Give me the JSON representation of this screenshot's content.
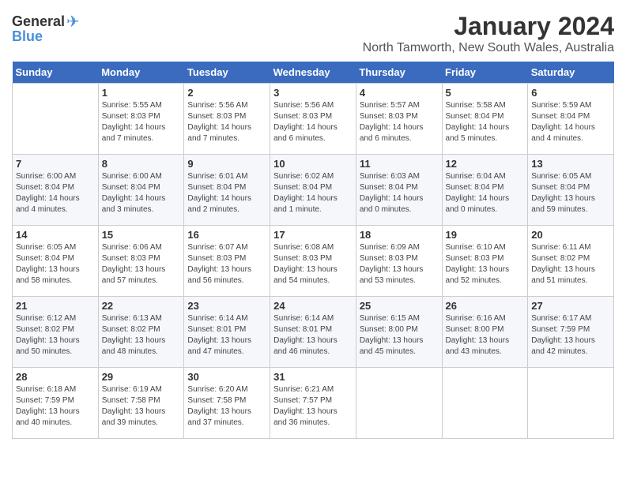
{
  "header": {
    "logo": {
      "general": "General",
      "blue": "Blue"
    },
    "title": "January 2024",
    "location": "North Tamworth, New South Wales, Australia"
  },
  "weekdays": [
    "Sunday",
    "Monday",
    "Tuesday",
    "Wednesday",
    "Thursday",
    "Friday",
    "Saturday"
  ],
  "weeks": [
    [
      {
        "day": "",
        "empty": true
      },
      {
        "day": "1",
        "sunrise": "Sunrise: 5:55 AM",
        "sunset": "Sunset: 8:03 PM",
        "daylight": "Daylight: 14 hours and 7 minutes."
      },
      {
        "day": "2",
        "sunrise": "Sunrise: 5:56 AM",
        "sunset": "Sunset: 8:03 PM",
        "daylight": "Daylight: 14 hours and 7 minutes."
      },
      {
        "day": "3",
        "sunrise": "Sunrise: 5:56 AM",
        "sunset": "Sunset: 8:03 PM",
        "daylight": "Daylight: 14 hours and 6 minutes."
      },
      {
        "day": "4",
        "sunrise": "Sunrise: 5:57 AM",
        "sunset": "Sunset: 8:03 PM",
        "daylight": "Daylight: 14 hours and 6 minutes."
      },
      {
        "day": "5",
        "sunrise": "Sunrise: 5:58 AM",
        "sunset": "Sunset: 8:04 PM",
        "daylight": "Daylight: 14 hours and 5 minutes."
      },
      {
        "day": "6",
        "sunrise": "Sunrise: 5:59 AM",
        "sunset": "Sunset: 8:04 PM",
        "daylight": "Daylight: 14 hours and 4 minutes."
      }
    ],
    [
      {
        "day": "7",
        "sunrise": "Sunrise: 6:00 AM",
        "sunset": "Sunset: 8:04 PM",
        "daylight": "Daylight: 14 hours and 4 minutes."
      },
      {
        "day": "8",
        "sunrise": "Sunrise: 6:00 AM",
        "sunset": "Sunset: 8:04 PM",
        "daylight": "Daylight: 14 hours and 3 minutes."
      },
      {
        "day": "9",
        "sunrise": "Sunrise: 6:01 AM",
        "sunset": "Sunset: 8:04 PM",
        "daylight": "Daylight: 14 hours and 2 minutes."
      },
      {
        "day": "10",
        "sunrise": "Sunrise: 6:02 AM",
        "sunset": "Sunset: 8:04 PM",
        "daylight": "Daylight: 14 hours and 1 minute."
      },
      {
        "day": "11",
        "sunrise": "Sunrise: 6:03 AM",
        "sunset": "Sunset: 8:04 PM",
        "daylight": "Daylight: 14 hours and 0 minutes."
      },
      {
        "day": "12",
        "sunrise": "Sunrise: 6:04 AM",
        "sunset": "Sunset: 8:04 PM",
        "daylight": "Daylight: 14 hours and 0 minutes."
      },
      {
        "day": "13",
        "sunrise": "Sunrise: 6:05 AM",
        "sunset": "Sunset: 8:04 PM",
        "daylight": "Daylight: 13 hours and 59 minutes."
      }
    ],
    [
      {
        "day": "14",
        "sunrise": "Sunrise: 6:05 AM",
        "sunset": "Sunset: 8:04 PM",
        "daylight": "Daylight: 13 hours and 58 minutes."
      },
      {
        "day": "15",
        "sunrise": "Sunrise: 6:06 AM",
        "sunset": "Sunset: 8:03 PM",
        "daylight": "Daylight: 13 hours and 57 minutes."
      },
      {
        "day": "16",
        "sunrise": "Sunrise: 6:07 AM",
        "sunset": "Sunset: 8:03 PM",
        "daylight": "Daylight: 13 hours and 56 minutes."
      },
      {
        "day": "17",
        "sunrise": "Sunrise: 6:08 AM",
        "sunset": "Sunset: 8:03 PM",
        "daylight": "Daylight: 13 hours and 54 minutes."
      },
      {
        "day": "18",
        "sunrise": "Sunrise: 6:09 AM",
        "sunset": "Sunset: 8:03 PM",
        "daylight": "Daylight: 13 hours and 53 minutes."
      },
      {
        "day": "19",
        "sunrise": "Sunrise: 6:10 AM",
        "sunset": "Sunset: 8:03 PM",
        "daylight": "Daylight: 13 hours and 52 minutes."
      },
      {
        "day": "20",
        "sunrise": "Sunrise: 6:11 AM",
        "sunset": "Sunset: 8:02 PM",
        "daylight": "Daylight: 13 hours and 51 minutes."
      }
    ],
    [
      {
        "day": "21",
        "sunrise": "Sunrise: 6:12 AM",
        "sunset": "Sunset: 8:02 PM",
        "daylight": "Daylight: 13 hours and 50 minutes."
      },
      {
        "day": "22",
        "sunrise": "Sunrise: 6:13 AM",
        "sunset": "Sunset: 8:02 PM",
        "daylight": "Daylight: 13 hours and 48 minutes."
      },
      {
        "day": "23",
        "sunrise": "Sunrise: 6:14 AM",
        "sunset": "Sunset: 8:01 PM",
        "daylight": "Daylight: 13 hours and 47 minutes."
      },
      {
        "day": "24",
        "sunrise": "Sunrise: 6:14 AM",
        "sunset": "Sunset: 8:01 PM",
        "daylight": "Daylight: 13 hours and 46 minutes."
      },
      {
        "day": "25",
        "sunrise": "Sunrise: 6:15 AM",
        "sunset": "Sunset: 8:00 PM",
        "daylight": "Daylight: 13 hours and 45 minutes."
      },
      {
        "day": "26",
        "sunrise": "Sunrise: 6:16 AM",
        "sunset": "Sunset: 8:00 PM",
        "daylight": "Daylight: 13 hours and 43 minutes."
      },
      {
        "day": "27",
        "sunrise": "Sunrise: 6:17 AM",
        "sunset": "Sunset: 7:59 PM",
        "daylight": "Daylight: 13 hours and 42 minutes."
      }
    ],
    [
      {
        "day": "28",
        "sunrise": "Sunrise: 6:18 AM",
        "sunset": "Sunset: 7:59 PM",
        "daylight": "Daylight: 13 hours and 40 minutes."
      },
      {
        "day": "29",
        "sunrise": "Sunrise: 6:19 AM",
        "sunset": "Sunset: 7:58 PM",
        "daylight": "Daylight: 13 hours and 39 minutes."
      },
      {
        "day": "30",
        "sunrise": "Sunrise: 6:20 AM",
        "sunset": "Sunset: 7:58 PM",
        "daylight": "Daylight: 13 hours and 37 minutes."
      },
      {
        "day": "31",
        "sunrise": "Sunrise: 6:21 AM",
        "sunset": "Sunset: 7:57 PM",
        "daylight": "Daylight: 13 hours and 36 minutes."
      },
      {
        "day": "",
        "empty": true
      },
      {
        "day": "",
        "empty": true
      },
      {
        "day": "",
        "empty": true
      }
    ]
  ]
}
